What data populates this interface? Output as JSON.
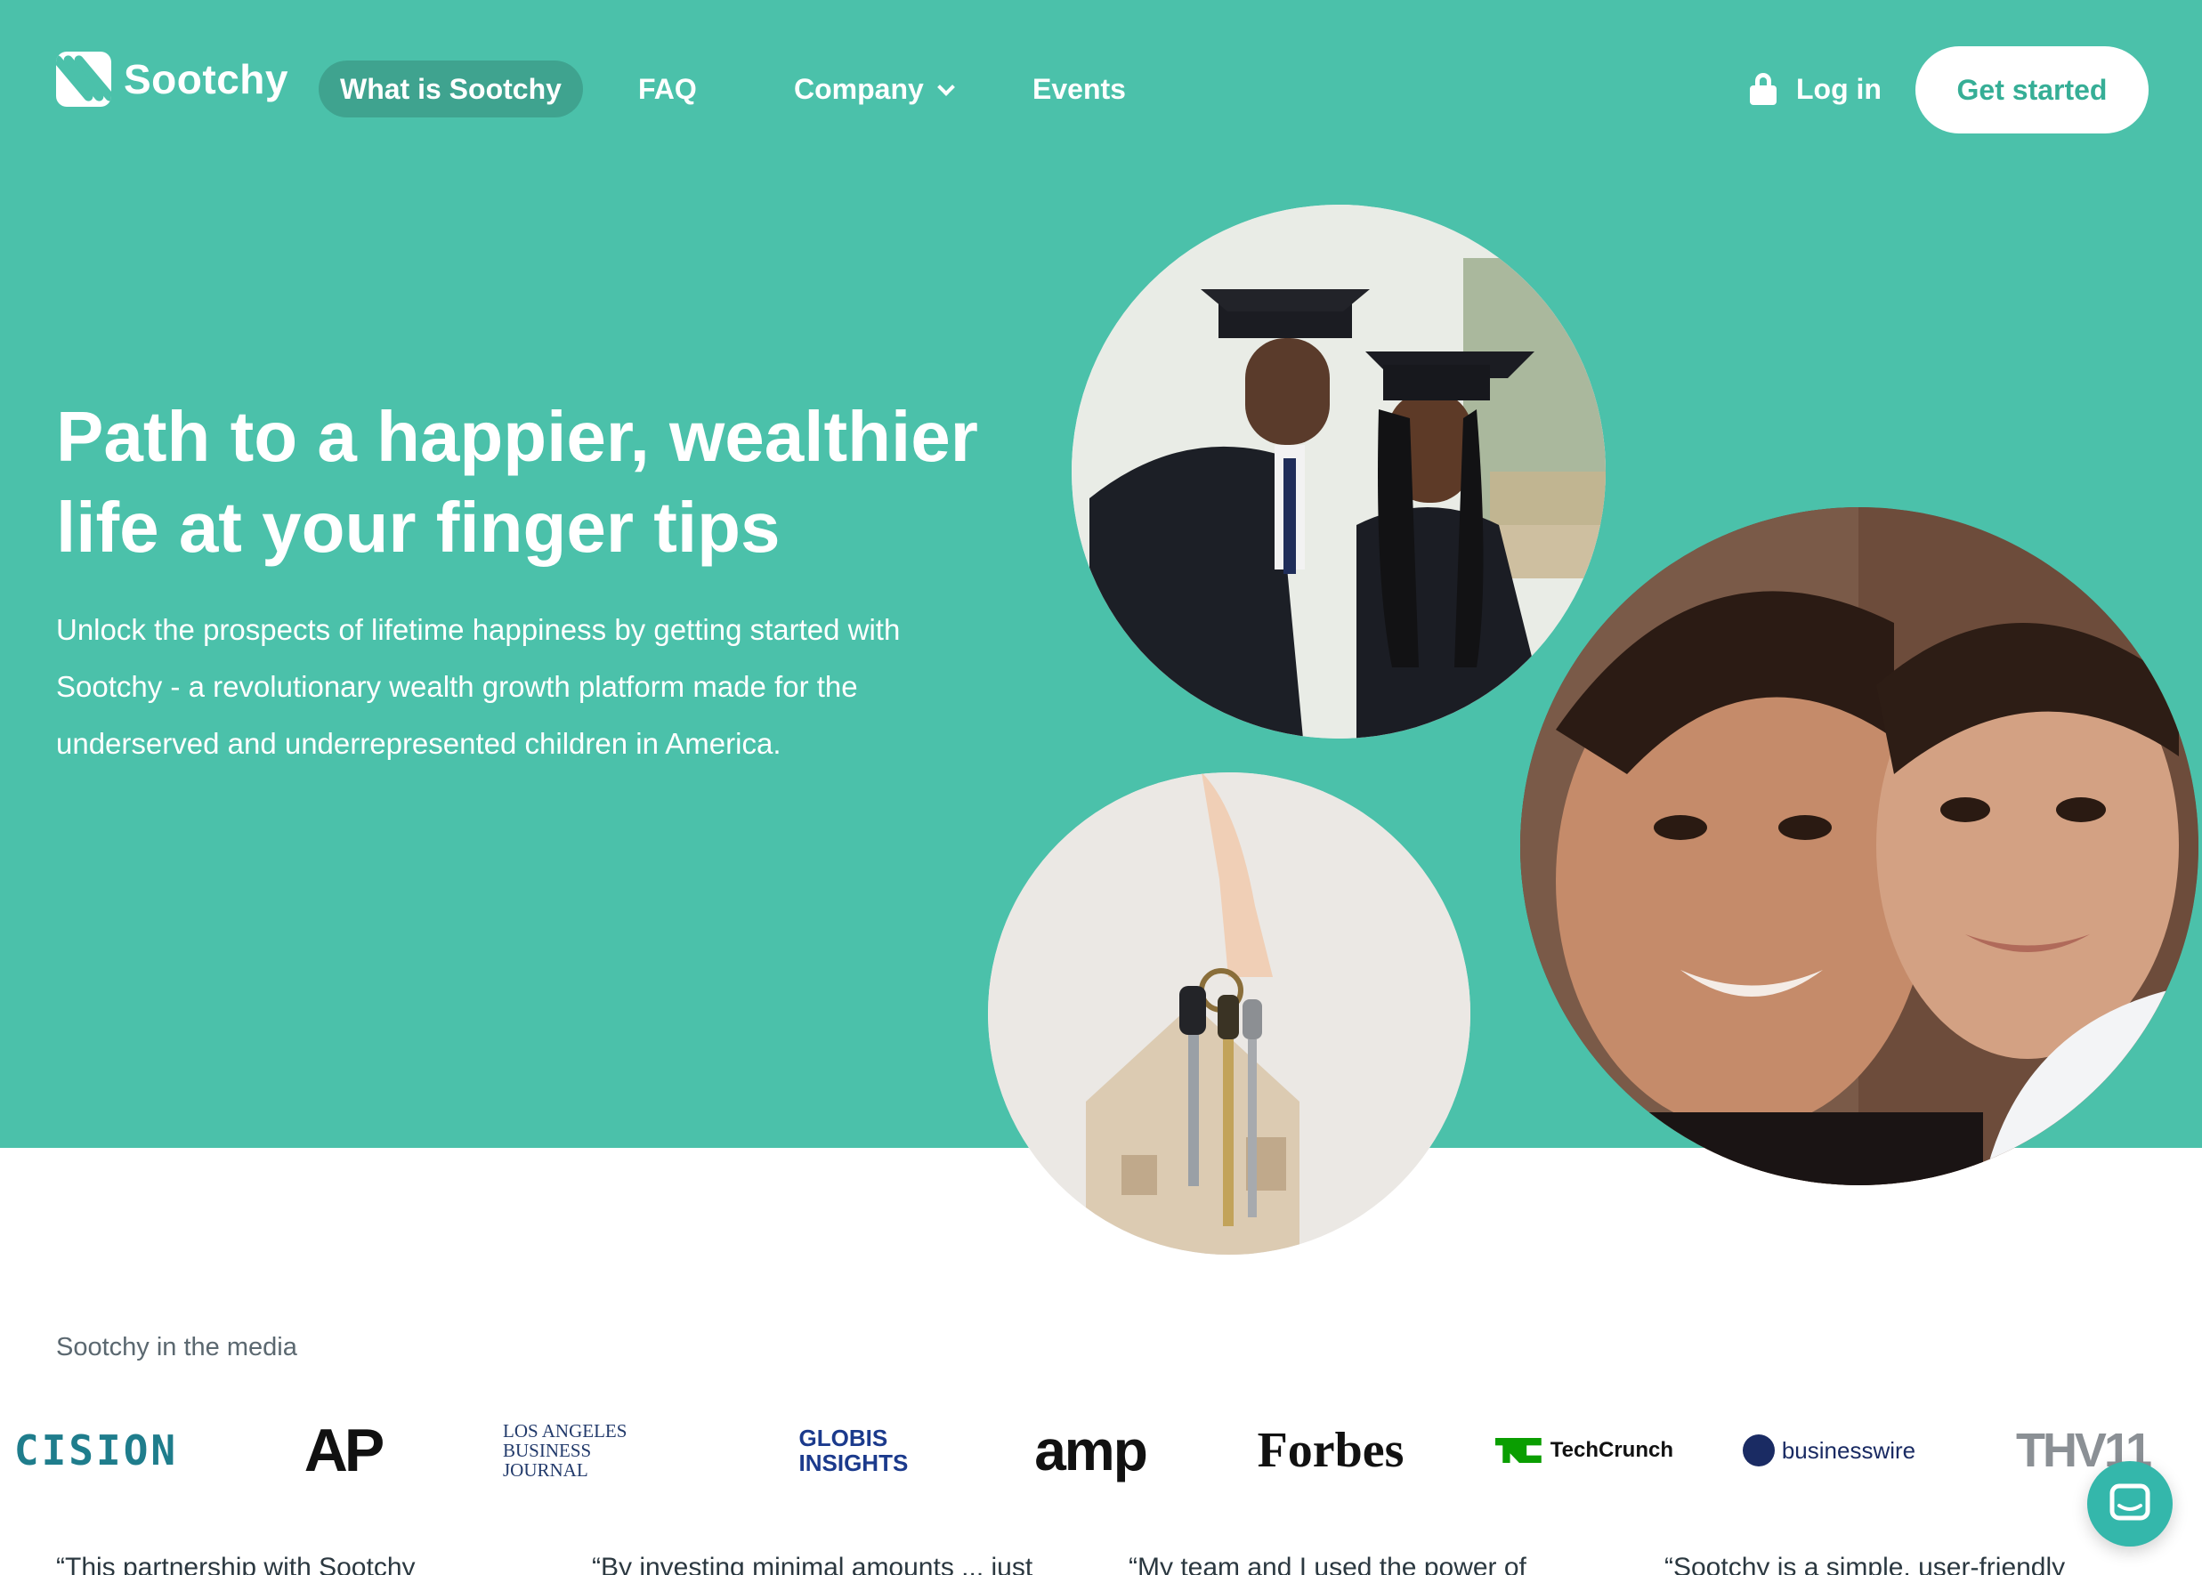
{
  "brand": {
    "name": "Sootchy",
    "accent": "#4bc1aa",
    "nav_active_bg": "#3fa38f",
    "cta_text_color": "#36ae96"
  },
  "nav": {
    "items": [
      {
        "label": "What is Sootchy",
        "active": true
      },
      {
        "label": "FAQ",
        "active": false
      },
      {
        "label": "Company",
        "active": false,
        "has_dropdown": true
      },
      {
        "label": "Events",
        "active": false
      }
    ],
    "login_label": "Log in",
    "login_icon": "lock-icon",
    "cta_label": "Get started"
  },
  "hero": {
    "headline": "Path to a happier, wealthier life at your finger tips",
    "subtext": "Unlock the prospects of lifetime happiness by getting started with Sootchy - a revolutionary wealth growth platform made for the underserved and underrepresented children in America."
  },
  "media": {
    "title": "Sootchy in the media",
    "logos": [
      "CISION",
      "AP",
      "Los Angeles Business Journal",
      "GLOBIS INSIGHTS",
      "amp",
      "Forbes",
      "TechCrunch",
      "businesswire",
      "THV11"
    ]
  },
  "testimonials": {
    "snippets": [
      "“This partnership with Sootchy",
      "“By investing minimal amounts ... just",
      "“My team and I used the power of",
      "“Sootchy is a simple, user-friendly"
    ]
  },
  "chat_widget": {
    "icon": "chat-icon"
  }
}
